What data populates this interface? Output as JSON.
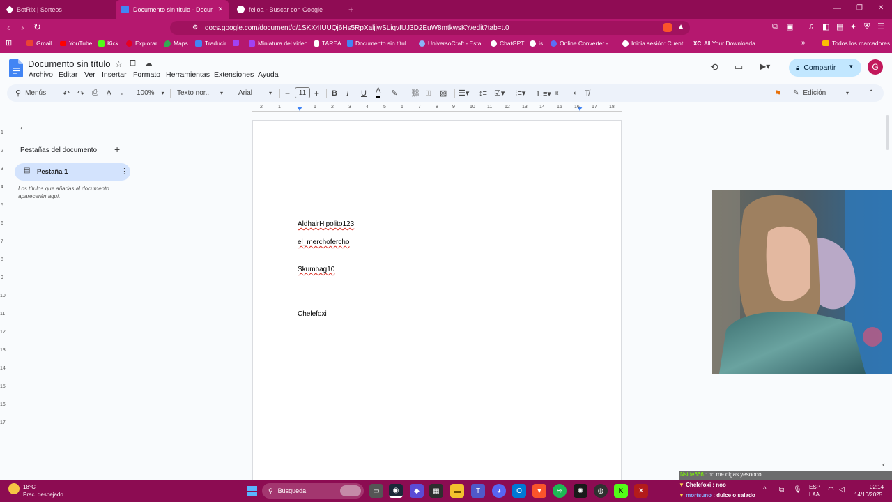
{
  "browser": {
    "tabs": [
      {
        "title": "BotRix | Sorteos",
        "active": false
      },
      {
        "title": "Documento sin título - Docume",
        "active": true
      },
      {
        "title": "feijoa - Buscar con Google",
        "active": false
      }
    ],
    "url": "docs.google.com/document/d/1SKX4IUUQj6Hs5RpXaljjwSLiqvIUJ3D2EuW8mtkwsKY/edit?tab=t.0",
    "bookmarks": [
      "Gmail",
      "YouTube",
      "Kick",
      "Explorar",
      "Maps",
      "Traducir",
      "Miniatura del video",
      "TAREA",
      "Documento sin títul...",
      "UniversoCraft - Esta...",
      "ChatGPT",
      "is",
      "Online Converter -...",
      "Inicia sesión: Cuent...",
      "All Your Downloada..."
    ],
    "bookmarks_folder": "Todos los marcadores",
    "accent_color": "#b5186f"
  },
  "docs": {
    "title": "Documento sin título",
    "menus": [
      "Archivo",
      "Editar",
      "Ver",
      "Insertar",
      "Formato",
      "Herramientas",
      "Extensiones",
      "Ayuda"
    ],
    "share_label": "Compartir",
    "avatar_letter": "G",
    "toolbar": {
      "search_menus": "Menús",
      "zoom": "100%",
      "style": "Texto nor...",
      "font": "Arial",
      "font_size": "11",
      "mode": "Edición"
    },
    "ruler_numbers": [
      "2",
      "1",
      "1",
      "2",
      "3",
      "4",
      "5",
      "6",
      "7",
      "8",
      "9",
      "10",
      "11",
      "12",
      "13",
      "14",
      "15",
      "16",
      "17",
      "18"
    ],
    "vruler_numbers": [
      "1",
      "2",
      "3",
      "4",
      "5",
      "6",
      "7",
      "8",
      "9",
      "10",
      "11",
      "12",
      "13",
      "14",
      "15",
      "16",
      "17"
    ],
    "sidebar": {
      "heading": "Pestañas del documento",
      "tab_label": "Pestaña 1",
      "hint": "Los títulos que añadas al documento aparecerán aquí."
    },
    "content": [
      "AldhairHipolito123",
      "el_merchoferchо",
      "Skumbag10",
      "Chelefoxi"
    ]
  },
  "taskbar": {
    "weather_temp": "18°C",
    "weather_desc": "Prac. despejado",
    "search": "Búsqueda",
    "lang1": "ESP",
    "lang2": "LAA",
    "time": "02:14",
    "date": "14/10/2025"
  },
  "chat": [
    {
      "user": "Nside666",
      "msg": "no me digas yesoooo",
      "user_color": "#7CFC00"
    },
    {
      "user": "Chelefoxi",
      "msg": "noo",
      "user_color": "#ffffff"
    },
    {
      "user": "mortsuno",
      "msg": "dulce o salado",
      "user_color": "#8ab4ff"
    }
  ]
}
